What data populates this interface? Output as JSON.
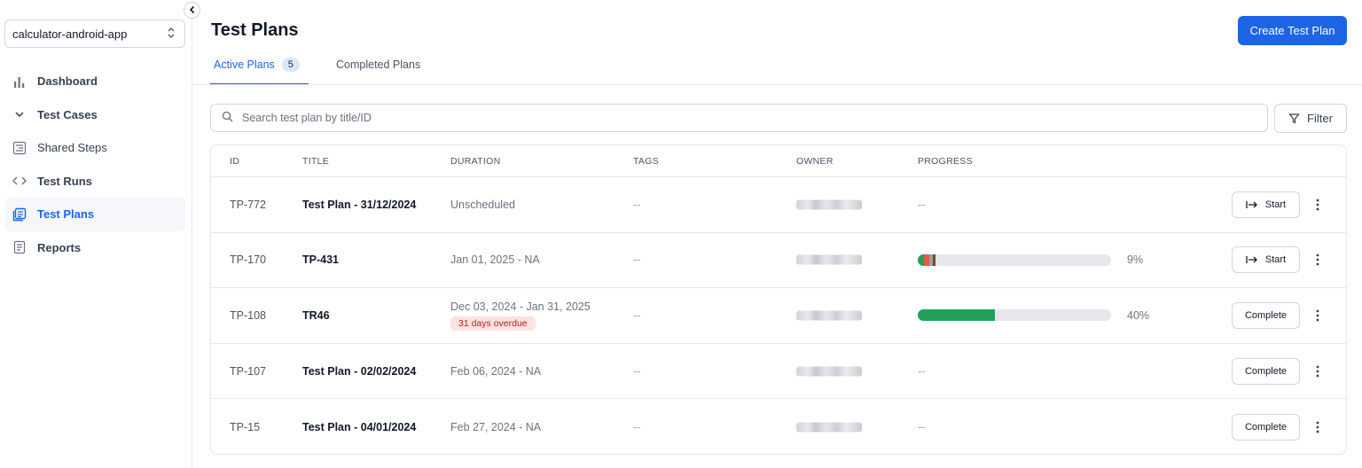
{
  "sidebar": {
    "project": "calculator-android-app",
    "items": [
      {
        "label": "Dashboard",
        "icon": "bar-chart-icon"
      },
      {
        "label": "Test Cases",
        "icon": "chevron-down-icon"
      },
      {
        "label": "Shared Steps",
        "icon": "shared-steps-icon"
      },
      {
        "label": "Test Runs",
        "icon": "code-brackets-icon"
      },
      {
        "label": "Test Plans",
        "icon": "test-plans-icon"
      },
      {
        "label": "Reports",
        "icon": "report-icon"
      }
    ]
  },
  "header": {
    "title": "Test Plans",
    "create_label": "Create Test Plan",
    "tabs": [
      {
        "label": "Active Plans",
        "badge": "5"
      },
      {
        "label": "Completed Plans"
      }
    ]
  },
  "search": {
    "placeholder": "Search test plan by title/ID",
    "filter_label": "Filter"
  },
  "table": {
    "columns": [
      "ID",
      "TITLE",
      "DURATION",
      "TAGS",
      "OWNER",
      "PROGRESS"
    ],
    "rows": [
      {
        "id": "TP-772",
        "title": "Test Plan - 31/12/2024",
        "duration": "Unscheduled",
        "tags": "--",
        "progress": "--",
        "action": "Start"
      },
      {
        "id": "TP-170",
        "title": "TP-431",
        "duration": "Jan 01, 2025 - NA",
        "tags": "--",
        "progress": "9%",
        "action": "Start"
      },
      {
        "id": "TP-108",
        "title": "TR46",
        "duration": "Dec 03, 2024 - Jan 31, 2025",
        "overdue": "31 days overdue",
        "tags": "--",
        "progress": "40%",
        "action": "Complete"
      },
      {
        "id": "TP-107",
        "title": "Test Plan - 02/02/2024",
        "duration": "Feb 06, 2024 - NA",
        "tags": "--",
        "progress": "--",
        "action": "Complete"
      },
      {
        "id": "TP-15",
        "title": "Test Plan - 04/01/2024",
        "duration": "Feb 27, 2024 - NA",
        "tags": "--",
        "progress": "--",
        "action": "Complete"
      }
    ],
    "progress_bars": {
      "row1": {
        "segments": [
          {
            "fraction": 0.03,
            "color": "#22a05a"
          },
          {
            "fraction": 0.03,
            "color": "#e15b3c"
          },
          {
            "fraction": 0.02,
            "color": "#9aa0a6"
          },
          {
            "fraction": 0.01,
            "color": "#6b4f2a"
          }
        ]
      },
      "row2": {
        "segments": [
          {
            "fraction": 0.4,
            "color": "#22a05a"
          }
        ]
      }
    }
  },
  "colors": {
    "accent": "#1d64e6",
    "success": "#22a05a",
    "danger": "#e15b3c"
  }
}
